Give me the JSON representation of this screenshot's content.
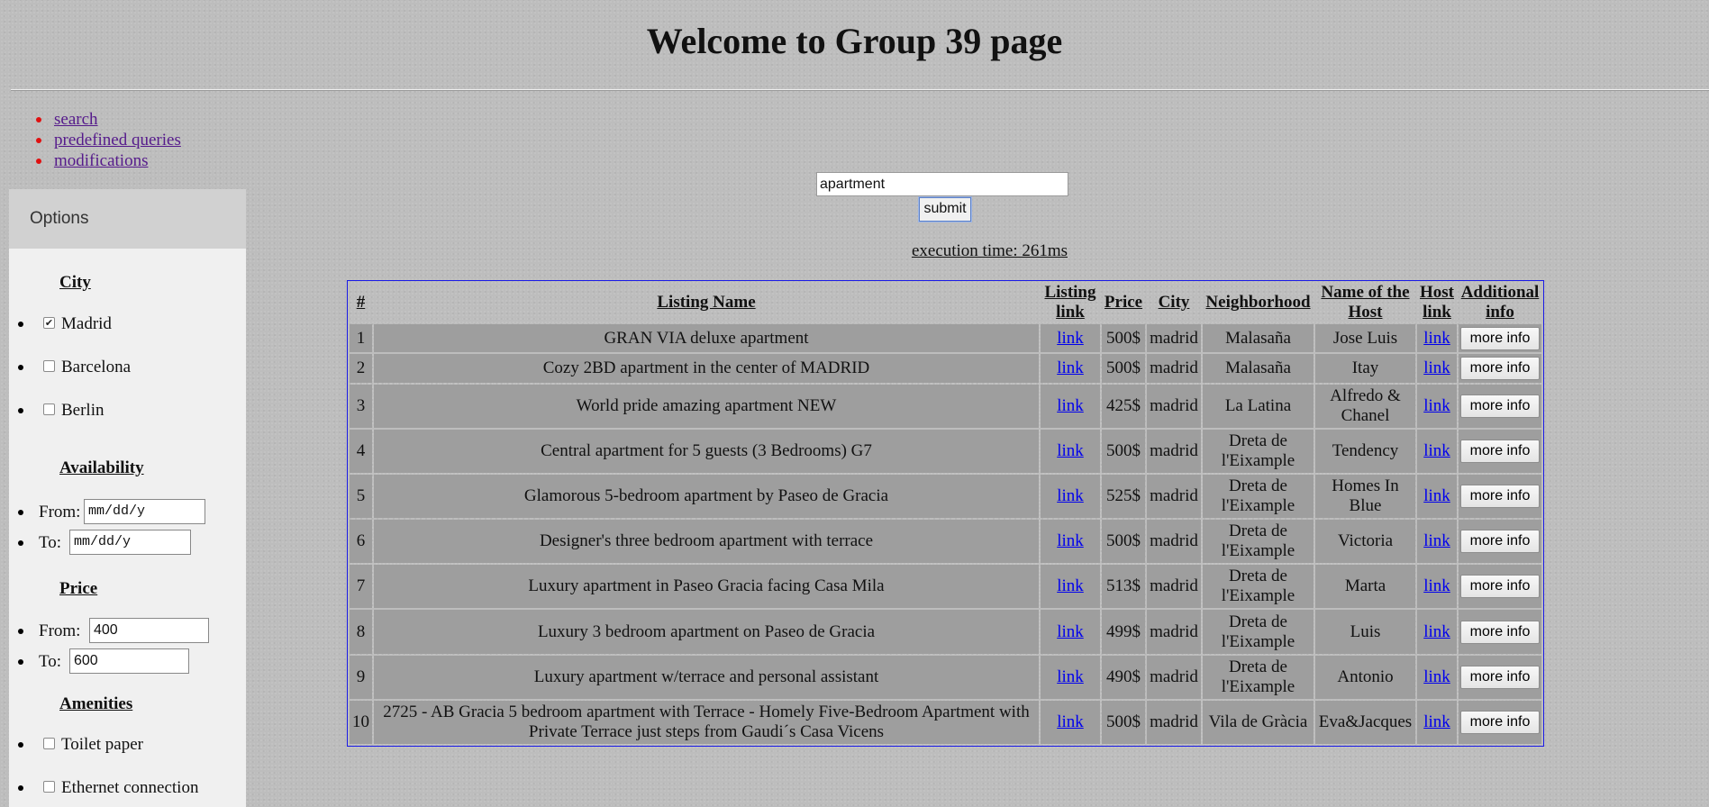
{
  "page": {
    "title": "Welcome to Group 39 page"
  },
  "nav": {
    "items": [
      "search",
      "predefined queries",
      "modifications"
    ]
  },
  "sidebar": {
    "header": "Options",
    "city": {
      "heading": "City",
      "options": [
        {
          "label": "Madrid",
          "checked": true
        },
        {
          "label": "Barcelona",
          "checked": false
        },
        {
          "label": "Berlin",
          "checked": false
        }
      ]
    },
    "availability": {
      "heading": "Availability",
      "from_label": "From:",
      "from_placeholder": "mm/dd/y",
      "to_label": "To:",
      "to_placeholder": "mm/dd/y"
    },
    "price": {
      "heading": "Price",
      "from_label": "From:",
      "from_value": "400",
      "to_label": "To:",
      "to_value": "600"
    },
    "amenities": {
      "heading": "Amenities",
      "options": [
        {
          "label": "Toilet paper",
          "checked": false
        },
        {
          "label": "Ethernet connection",
          "checked": false
        }
      ]
    }
  },
  "search": {
    "value": "apartment",
    "submit_label": "submit"
  },
  "execution_time": "execution time: 261ms",
  "table": {
    "headers": [
      "#",
      "Listing Name",
      "Listing link",
      "Price",
      "City",
      "Neighborhood",
      "Name of the Host",
      "Host link",
      "Additional info"
    ],
    "rows": [
      {
        "num": "1",
        "name": "GRAN VIA deluxe apartment",
        "listing_link": "link",
        "price": "500$",
        "city": "madrid",
        "neighborhood": "Malasaña",
        "host": "Jose Luis",
        "host_link": "link",
        "more": "more info"
      },
      {
        "num": "2",
        "name": "Cozy 2BD apartment in the center of MADRID",
        "listing_link": "link",
        "price": "500$",
        "city": "madrid",
        "neighborhood": "Malasaña",
        "host": "Itay",
        "host_link": "link",
        "more": "more info"
      },
      {
        "num": "3",
        "name": "World pride amazing apartment NEW",
        "listing_link": "link",
        "price": "425$",
        "city": "madrid",
        "neighborhood": "La Latina",
        "host": "Alfredo & Chanel",
        "host_link": "link",
        "more": "more info"
      },
      {
        "num": "4",
        "name": "Central apartment for 5 guests (3 Bedrooms) G7",
        "listing_link": "link",
        "price": "500$",
        "city": "madrid",
        "neighborhood": "Dreta de l'Eixample",
        "host": "Tendency",
        "host_link": "link",
        "more": "more info"
      },
      {
        "num": "5",
        "name": "Glamorous 5-bedroom apartment by Paseo de Gracia",
        "listing_link": "link",
        "price": "525$",
        "city": "madrid",
        "neighborhood": "Dreta de l'Eixample",
        "host": "Homes In Blue",
        "host_link": "link",
        "more": "more info"
      },
      {
        "num": "6",
        "name": "Designer's three bedroom apartment with terrace",
        "listing_link": "link",
        "price": "500$",
        "city": "madrid",
        "neighborhood": "Dreta de l'Eixample",
        "host": "Victoria",
        "host_link": "link",
        "more": "more info"
      },
      {
        "num": "7",
        "name": "Luxury apartment in Paseo Gracia facing Casa Mila",
        "listing_link": "link",
        "price": "513$",
        "city": "madrid",
        "neighborhood": "Dreta de l'Eixample",
        "host": "Marta",
        "host_link": "link",
        "more": "more info"
      },
      {
        "num": "8",
        "name": "Luxury 3 bedroom apartment on Paseo de Gracia",
        "listing_link": "link",
        "price": "499$",
        "city": "madrid",
        "neighborhood": "Dreta de l'Eixample",
        "host": "Luis",
        "host_link": "link",
        "more": "more info"
      },
      {
        "num": "9",
        "name": "Luxury apartment w/terrace and personal assistant",
        "listing_link": "link",
        "price": "490$",
        "city": "madrid",
        "neighborhood": "Dreta de l'Eixample",
        "host": "Antonio",
        "host_link": "link",
        "more": "more info"
      },
      {
        "num": "10",
        "name": "2725 - AB Gracia 5 bedroom apartment with Terrace - Homely Five-Bedroom Apartment with Private Terrace just steps from Gaudi´s Casa Vicens",
        "listing_link": "link",
        "price": "500$",
        "city": "madrid",
        "neighborhood": "Vila de Gràcia",
        "host": "Eva&Jacques",
        "host_link": "link",
        "more": "more info"
      }
    ]
  }
}
